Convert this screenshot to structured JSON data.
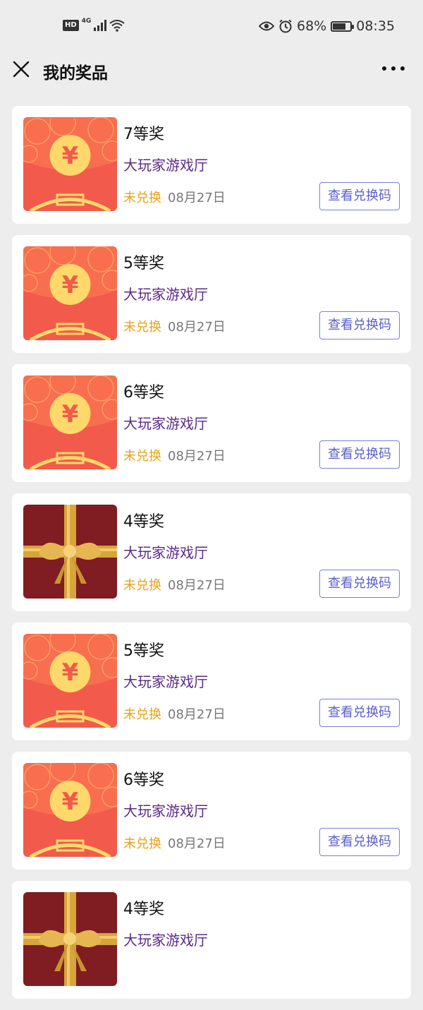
{
  "status_bar": {
    "hd": "HD",
    "network": "4G",
    "battery": "68%",
    "battery_level": 0.68,
    "time": "08:35"
  },
  "header": {
    "title": "我的奖品"
  },
  "prizes": [
    {
      "name": "7等奖",
      "source": "大玩家游戏厅",
      "status": "未兑换",
      "date": "08月27日",
      "button": "查看兑换码",
      "image": "red-envelope-icon"
    },
    {
      "name": "5等奖",
      "source": "大玩家游戏厅",
      "status": "未兑换",
      "date": "08月27日",
      "button": "查看兑换码",
      "image": "red-envelope-icon"
    },
    {
      "name": "6等奖",
      "source": "大玩家游戏厅",
      "status": "未兑换",
      "date": "08月27日",
      "button": "查看兑换码",
      "image": "red-envelope-icon"
    },
    {
      "name": "4等奖",
      "source": "大玩家游戏厅",
      "status": "未兑换",
      "date": "08月27日",
      "button": "查看兑换码",
      "image": "gift-box-icon"
    },
    {
      "name": "5等奖",
      "source": "大玩家游戏厅",
      "status": "未兑换",
      "date": "08月27日",
      "button": "查看兑换码",
      "image": "red-envelope-icon"
    },
    {
      "name": "6等奖",
      "source": "大玩家游戏厅",
      "status": "未兑换",
      "date": "08月27日",
      "button": "查看兑换码",
      "image": "red-envelope-icon"
    },
    {
      "name": "4等奖",
      "source": "大玩家游戏厅",
      "status": "",
      "date": "",
      "button": "",
      "image": "gift-box-icon"
    }
  ],
  "colors": {
    "background": "#ededed",
    "source_text": "#5b2a86",
    "status_text": "#e8a317",
    "button_border": "#7b7fd8"
  }
}
